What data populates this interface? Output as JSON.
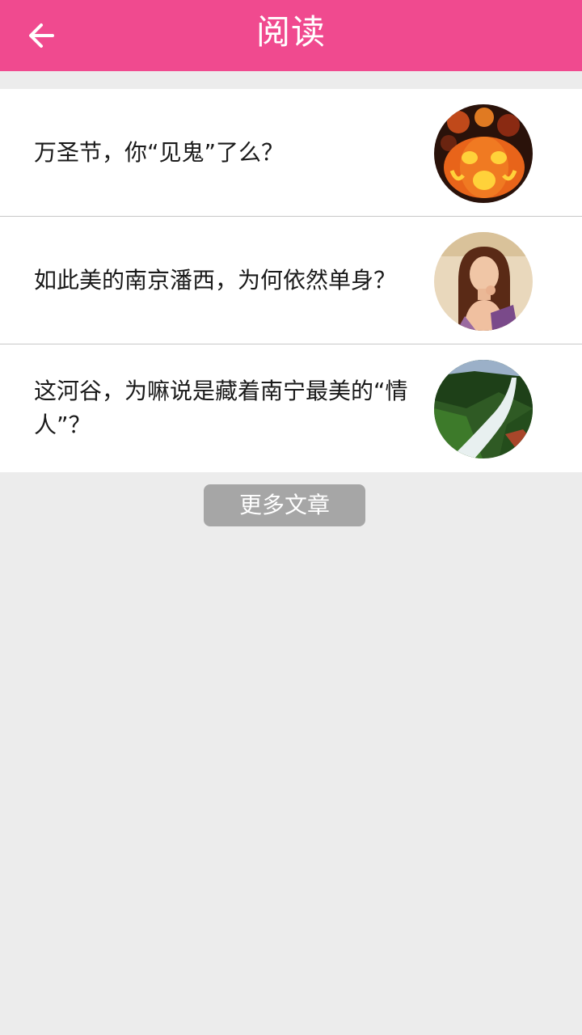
{
  "header": {
    "title": "阅读",
    "back_icon": "arrow-left-icon",
    "background_color": "#f04a8f"
  },
  "articles": [
    {
      "title": "万圣节，你“见鬼”了么？",
      "thumbnail": "halloween-pumpkin-image"
    },
    {
      "title": "如此美的南京潘西，为何依然单身？",
      "thumbnail": "woman-portrait-image"
    },
    {
      "title": "这河谷，为嘛说是藏着南宁最美的“情人”？",
      "thumbnail": "river-valley-image"
    }
  ],
  "more_button": {
    "label": "更多文章",
    "color": "#a6a6a6"
  }
}
